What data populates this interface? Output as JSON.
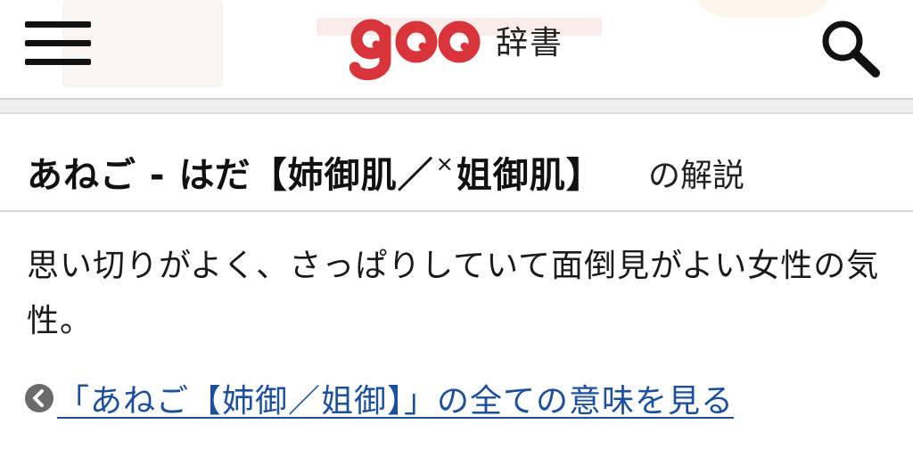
{
  "header": {
    "logo_text": "goo",
    "logo_subtitle": "辞書",
    "brand_color": "#d8343a",
    "menu_icon": "hamburger-menu-icon",
    "search_icon": "search-icon"
  },
  "entry": {
    "title_prefix": "あねご - はだ",
    "bracket_open": "【",
    "title_kanji_1": "姉御肌／",
    "title_mark": "×",
    "title_kanji_2": "姐御肌",
    "bracket_close": "】",
    "title_suffix": "の解説"
  },
  "definition": {
    "text": "思い切りがよく、さっぱりしていて面倒見がよい女性の気性。"
  },
  "more_link": {
    "label": "「あねご【姉御／姐御】」の全ての意味を見る",
    "icon": "chevron-left-circle-icon",
    "color": "#1c4f9c"
  }
}
